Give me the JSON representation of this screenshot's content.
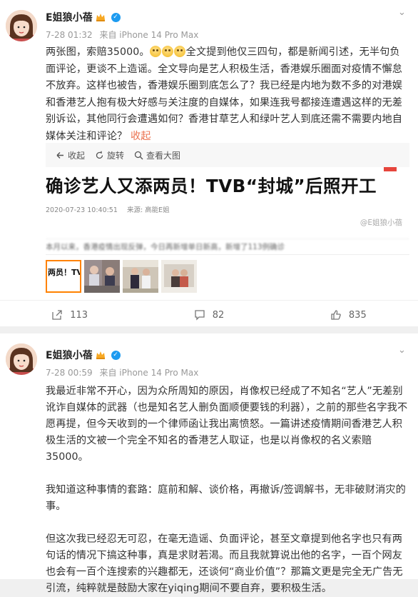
{
  "posts": [
    {
      "username": "E姐狼小蓓",
      "time": "7-28 01:32",
      "source": "来自 iPhone 14 Pro Max",
      "text_before_emoji": "两张图，索赔35000。",
      "text_after_emoji": "全文提到他仅三四句，都是新闻引述，无半句负面评论，更谈不上造谣。全文导向是艺人积极生活，香港娱乐圈面对疫情不懈怠不放弃。这样也被告，香港娱乐圈到底怎么了？我已经是内地为数不多的对港娱和香港艺人抱有极大好感与关注度的自媒体，如果连我号都接连遭遇这样的无差别诉讼，其他同行会遭遇如何？香港甘草艺人和绿叶艺人到底还需不需要内地自媒体关注和评论？",
      "collapse": "收起",
      "media_toolbar": {
        "collapse": "收起",
        "rotate": "旋转",
        "view_large": "查看大图"
      },
      "news_image": {
        "title": "确诊艺人又添两员！TVB“封城”后照开工",
        "date": "2020-07-23 10:40:51",
        "source_label": "来源: 高能E姐",
        "watermark": "@E姐狼小蓓",
        "blurred_line": "本月以来，香港疫情出现反弹，今日再新增单日新高，新增了113例确诊"
      },
      "thumbs": [
        "两员！TV"
      ],
      "actions": {
        "repost": "113",
        "comment": "82",
        "like": "835"
      }
    },
    {
      "username": "E姐狼小蓓",
      "time": "7-28 00:59",
      "source": "来自 iPhone 14 Pro Max",
      "paragraphs": [
        "我最近非常不开心，因为众所周知的原因，肖像权已经成了不知名“艺人”无差别讹诈自媒体的武器（也是知名艺人删负面顺便要钱的利器），之前的那些名字我不愿再提，但今天收到的一个律师函让我出离愤怒。一篇讲述疫情期间香港艺人积极生活的文被一个完全不知名的香港艺人取证，也是以肖像权的名义索赔35000。",
        "我知道这种事情的套路：庭前和解、谈价格，再撤诉/签调解书，无非破财消灾的事。",
        "但这次我已经忍无可忍，在毫无造谣、负面评论，甚至文章提到他名字也只有两句话的情况下搞这种事，真是求财若渴。而且我就算说出他的名字，一百个网友也会有一百个连搜索的兴趣都无，还谈何“商业价值”？那篇文更是完全无广告无引流，纯粹就是鼓励大家在yiqing期间不要自弃，要积极生活。"
      ]
    }
  ],
  "colors": {
    "accent": "#ff8200",
    "link": "#eb7350",
    "verified": "#1d9bf0"
  }
}
